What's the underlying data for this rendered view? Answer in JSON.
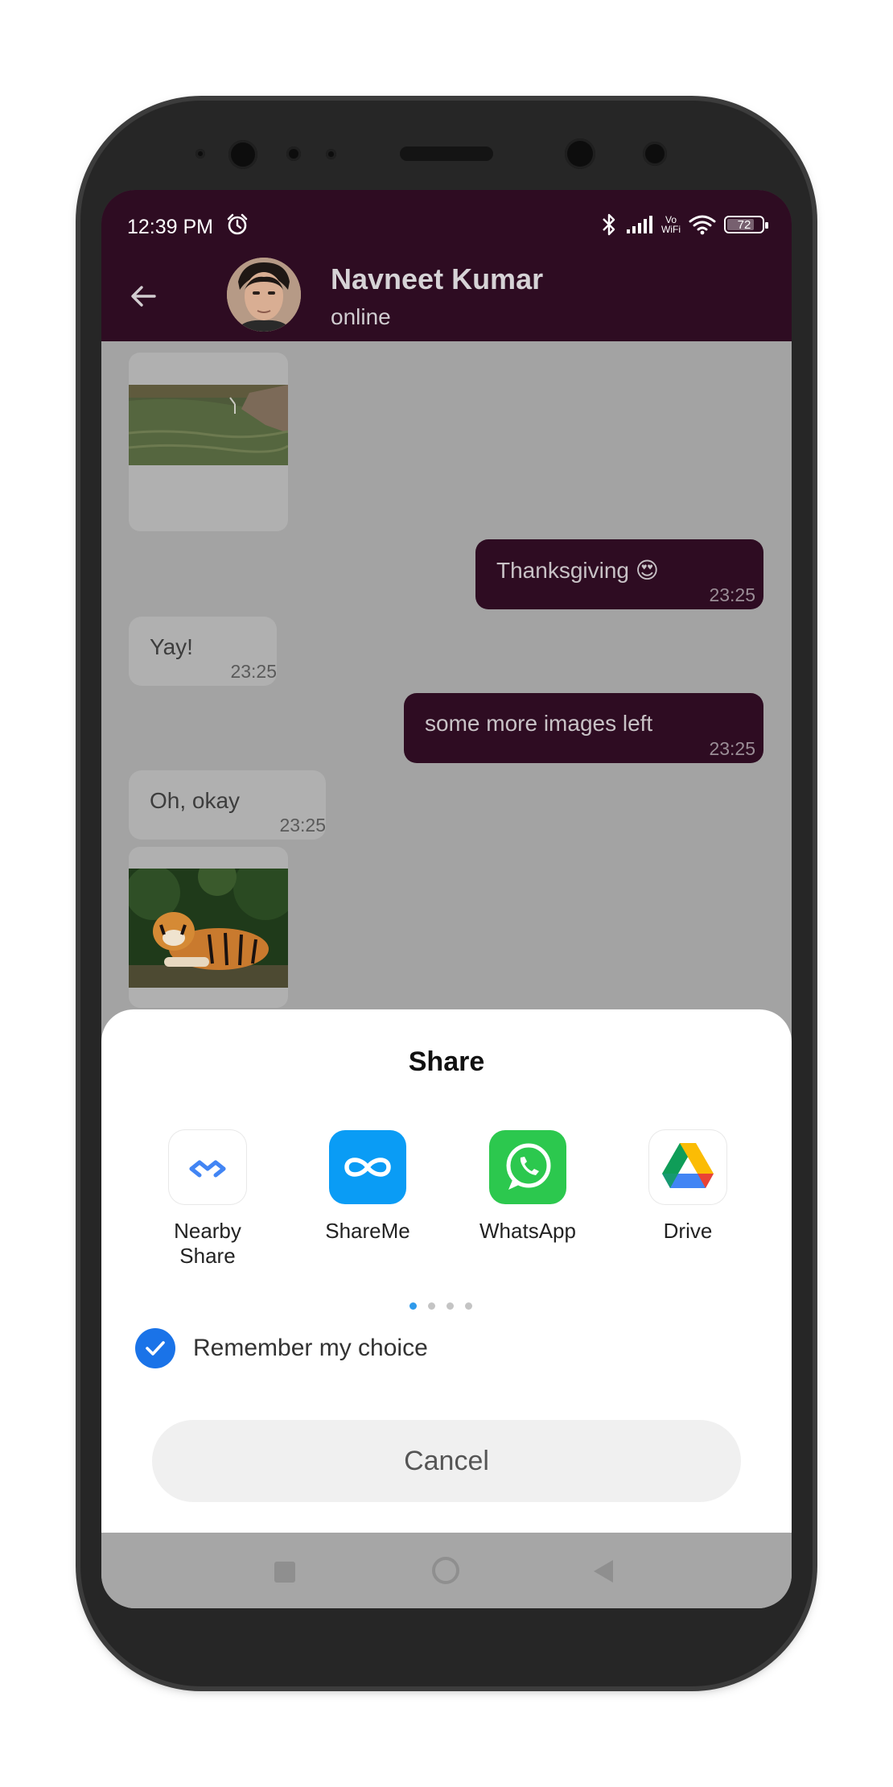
{
  "status_bar": {
    "time": "12:39 PM",
    "volte_top": "Vo",
    "volte_bottom": "WiFi",
    "battery": "72"
  },
  "header": {
    "contact_name": "Navneet Kumar",
    "contact_status": "online"
  },
  "messages": [
    {
      "direction": "out",
      "text": "Thanksgiving 😍",
      "time": "23:25"
    },
    {
      "direction": "in",
      "text": "Yay!",
      "time": "23:25"
    },
    {
      "direction": "out",
      "text": "some more images left",
      "time": "23:25"
    },
    {
      "direction": "in",
      "text": "Oh, okay",
      "time": "23:25"
    }
  ],
  "share_sheet": {
    "title": "Share",
    "apps": [
      {
        "label_line1": "Nearby",
        "label_line2": "Share",
        "icon": "nearby-share-icon"
      },
      {
        "label_line1": "ShareMe",
        "label_line2": "",
        "icon": "shareme-icon"
      },
      {
        "label_line1": "WhatsApp",
        "label_line2": "",
        "icon": "whatsapp-icon"
      },
      {
        "label_line1": "Drive",
        "label_line2": "",
        "icon": "google-drive-icon"
      }
    ],
    "pager": {
      "pages": 4,
      "active": 1
    },
    "remember_label": "Remember my choice",
    "remember_checked": true,
    "cancel_label": "Cancel"
  },
  "colors": {
    "header_bg": "#2e0c22",
    "outgoing_bubble": "#2e0c22",
    "checkbox": "#1a73e8"
  }
}
